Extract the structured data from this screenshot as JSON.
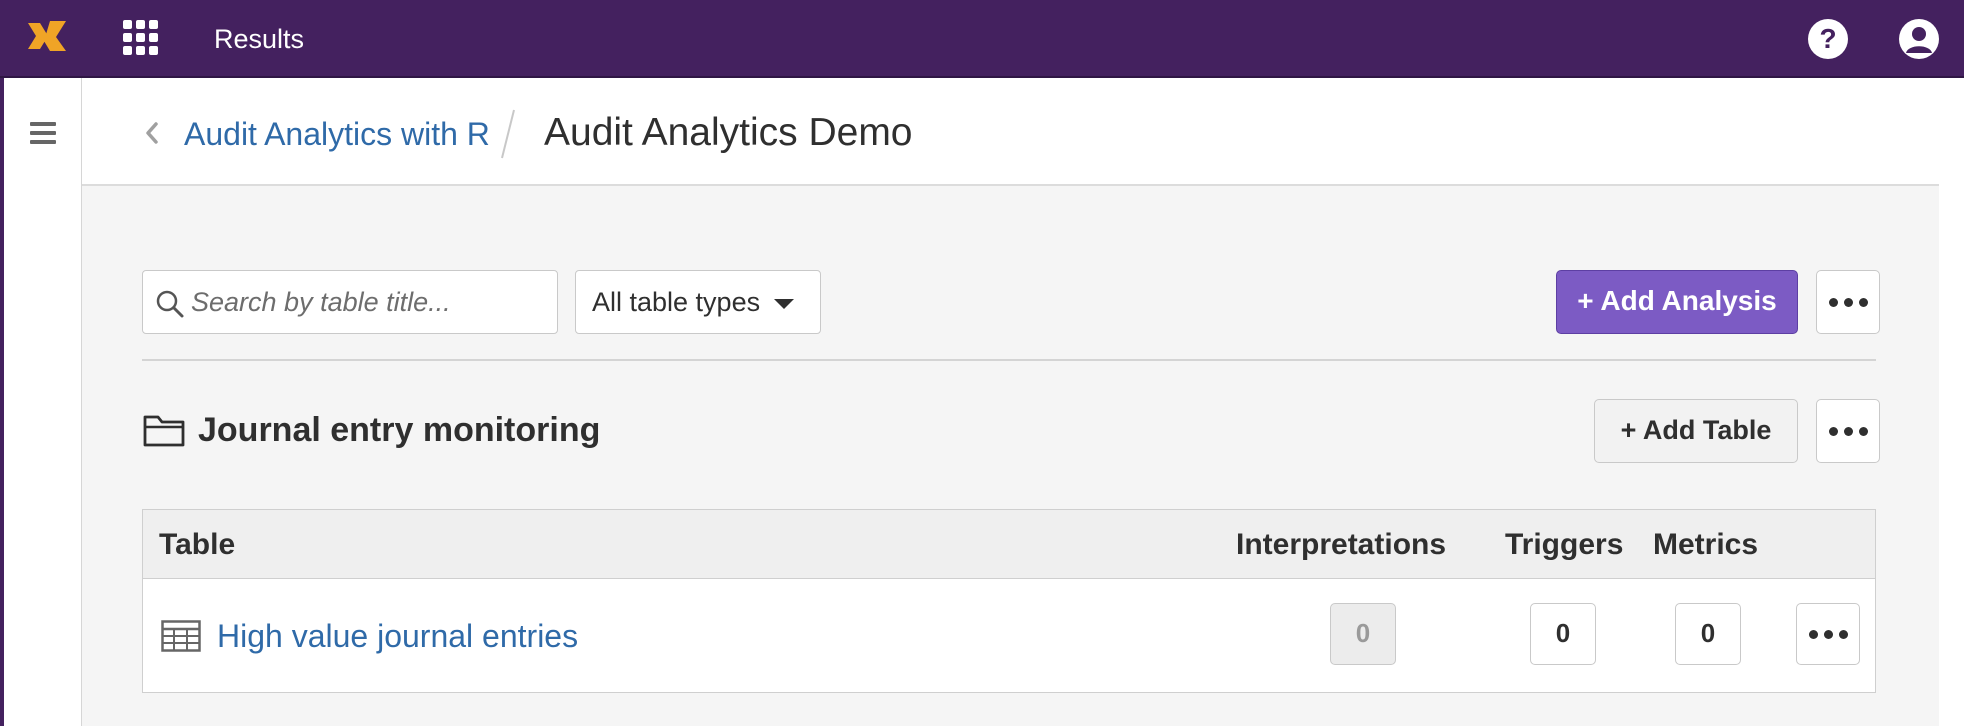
{
  "topbar": {
    "title": "Results",
    "logo_icon": "x-logo-icon",
    "apps_icon": "apps-grid-icon",
    "help_label": "?",
    "help_icon": "help-icon",
    "user_icon": "user-icon",
    "background": "#44215f",
    "logo_color": "#f0a426"
  },
  "sidebar": {
    "menu_icon": "hamburger-menu-icon"
  },
  "breadcrumb": {
    "back_icon": "chevron-left-icon",
    "parent": "Audit Analytics with R",
    "current": "Audit Analytics Demo"
  },
  "toolbar": {
    "search_placeholder": "Search by table title...",
    "search_value": "",
    "type_filter": "All table types",
    "add_analysis_label": "+ Add Analysis",
    "add_analysis_color": "#7c5bc4",
    "more_icon": "ellipsis-icon"
  },
  "folder": {
    "icon": "folder-icon",
    "title": "Journal entry monitoring",
    "add_table_label": "+ Add Table"
  },
  "table": {
    "columns": [
      "Table",
      "Interpretations",
      "Triggers",
      "Metrics"
    ],
    "rows": [
      {
        "icon": "table-icon",
        "title": "High value journal entries",
        "interpretations": "0",
        "triggers": "0",
        "metrics": "0"
      }
    ]
  }
}
